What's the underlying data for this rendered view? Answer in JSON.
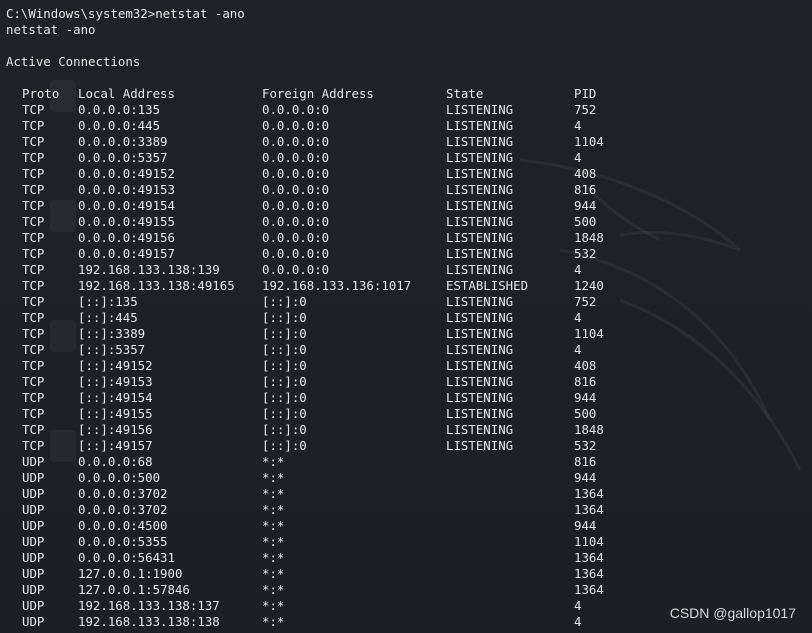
{
  "terminal": {
    "command": "C:\\Windows\\system32>netstat -ano",
    "echo": "netstat -ano",
    "section_title": "Active Connections",
    "headers": [
      "Proto",
      "Local Address",
      "Foreign Address",
      "State",
      "PID"
    ],
    "rows": [
      {
        "proto": "TCP",
        "local": "0.0.0.0:135",
        "foreign": "0.0.0.0:0",
        "state": "LISTENING",
        "pid": "752"
      },
      {
        "proto": "TCP",
        "local": "0.0.0.0:445",
        "foreign": "0.0.0.0:0",
        "state": "LISTENING",
        "pid": "4"
      },
      {
        "proto": "TCP",
        "local": "0.0.0.0:3389",
        "foreign": "0.0.0.0:0",
        "state": "LISTENING",
        "pid": "1104"
      },
      {
        "proto": "TCP",
        "local": "0.0.0.0:5357",
        "foreign": "0.0.0.0:0",
        "state": "LISTENING",
        "pid": "4"
      },
      {
        "proto": "TCP",
        "local": "0.0.0.0:49152",
        "foreign": "0.0.0.0:0",
        "state": "LISTENING",
        "pid": "408"
      },
      {
        "proto": "TCP",
        "local": "0.0.0.0:49153",
        "foreign": "0.0.0.0:0",
        "state": "LISTENING",
        "pid": "816"
      },
      {
        "proto": "TCP",
        "local": "0.0.0.0:49154",
        "foreign": "0.0.0.0:0",
        "state": "LISTENING",
        "pid": "944"
      },
      {
        "proto": "TCP",
        "local": "0.0.0.0:49155",
        "foreign": "0.0.0.0:0",
        "state": "LISTENING",
        "pid": "500"
      },
      {
        "proto": "TCP",
        "local": "0.0.0.0:49156",
        "foreign": "0.0.0.0:0",
        "state": "LISTENING",
        "pid": "1848"
      },
      {
        "proto": "TCP",
        "local": "0.0.0.0:49157",
        "foreign": "0.0.0.0:0",
        "state": "LISTENING",
        "pid": "532"
      },
      {
        "proto": "TCP",
        "local": "192.168.133.138:139",
        "foreign": "0.0.0.0:0",
        "state": "LISTENING",
        "pid": "4"
      },
      {
        "proto": "TCP",
        "local": "192.168.133.138:49165",
        "foreign": "192.168.133.136:1017",
        "state": "ESTABLISHED",
        "pid": "1240"
      },
      {
        "proto": "TCP",
        "local": "[::]:135",
        "foreign": "[::]:0",
        "state": "LISTENING",
        "pid": "752"
      },
      {
        "proto": "TCP",
        "local": "[::]:445",
        "foreign": "[::]:0",
        "state": "LISTENING",
        "pid": "4"
      },
      {
        "proto": "TCP",
        "local": "[::]:3389",
        "foreign": "[::]:0",
        "state": "LISTENING",
        "pid": "1104"
      },
      {
        "proto": "TCP",
        "local": "[::]:5357",
        "foreign": "[::]:0",
        "state": "LISTENING",
        "pid": "4"
      },
      {
        "proto": "TCP",
        "local": "[::]:49152",
        "foreign": "[::]:0",
        "state": "LISTENING",
        "pid": "408"
      },
      {
        "proto": "TCP",
        "local": "[::]:49153",
        "foreign": "[::]:0",
        "state": "LISTENING",
        "pid": "816"
      },
      {
        "proto": "TCP",
        "local": "[::]:49154",
        "foreign": "[::]:0",
        "state": "LISTENING",
        "pid": "944"
      },
      {
        "proto": "TCP",
        "local": "[::]:49155",
        "foreign": "[::]:0",
        "state": "LISTENING",
        "pid": "500"
      },
      {
        "proto": "TCP",
        "local": "[::]:49156",
        "foreign": "[::]:0",
        "state": "LISTENING",
        "pid": "1848"
      },
      {
        "proto": "TCP",
        "local": "[::]:49157",
        "foreign": "[::]:0",
        "state": "LISTENING",
        "pid": "532"
      },
      {
        "proto": "UDP",
        "local": "0.0.0.0:68",
        "foreign": "*:*",
        "state": "",
        "pid": "816"
      },
      {
        "proto": "UDP",
        "local": "0.0.0.0:500",
        "foreign": "*:*",
        "state": "",
        "pid": "944"
      },
      {
        "proto": "UDP",
        "local": "0.0.0.0:3702",
        "foreign": "*:*",
        "state": "",
        "pid": "1364"
      },
      {
        "proto": "UDP",
        "local": "0.0.0.0:3702",
        "foreign": "*:*",
        "state": "",
        "pid": "1364"
      },
      {
        "proto": "UDP",
        "local": "0.0.0.0:4500",
        "foreign": "*:*",
        "state": "",
        "pid": "944"
      },
      {
        "proto": "UDP",
        "local": "0.0.0.0:5355",
        "foreign": "*:*",
        "state": "",
        "pid": "1104"
      },
      {
        "proto": "UDP",
        "local": "0.0.0.0:56431",
        "foreign": "*:*",
        "state": "",
        "pid": "1364"
      },
      {
        "proto": "UDP",
        "local": "127.0.0.1:1900",
        "foreign": "*:*",
        "state": "",
        "pid": "1364"
      },
      {
        "proto": "UDP",
        "local": "127.0.0.1:57846",
        "foreign": "*:*",
        "state": "",
        "pid": "1364"
      },
      {
        "proto": "UDP",
        "local": "192.168.133.138:137",
        "foreign": "*:*",
        "state": "",
        "pid": "4"
      },
      {
        "proto": "UDP",
        "local": "192.168.133.138:138",
        "foreign": "*:*",
        "state": "",
        "pid": "4"
      }
    ]
  },
  "watermark": "CSDN @gallop1017",
  "colors": {
    "background": "#1e1f29",
    "text": "#e8e8e8"
  }
}
